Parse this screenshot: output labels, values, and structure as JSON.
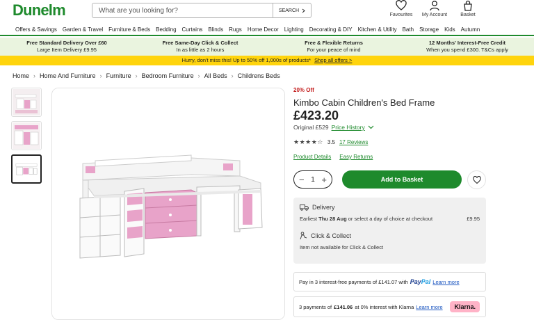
{
  "header": {
    "logo": "Dunelm",
    "search_placeholder": "What are you looking for?",
    "search_button": "SEARCH",
    "icons": [
      {
        "name": "heart-icon",
        "label": "Favourites"
      },
      {
        "name": "user-icon",
        "label": "My Account"
      },
      {
        "name": "basket-icon",
        "label": "Basket"
      }
    ]
  },
  "nav": [
    "Offers & Savings",
    "Garden & Travel",
    "Furniture & Beds",
    "Bedding",
    "Curtains",
    "Blinds",
    "Rugs",
    "Home Decor",
    "Lighting",
    "Decorating & DIY",
    "Kitchen & Utility",
    "Bath",
    "Storage",
    "Kids",
    "Autumn"
  ],
  "usp": [
    {
      "title": "Free Standard Delivery Over £60",
      "sub": "Large Item Delivery £9.95"
    },
    {
      "title": "Free Same-Day Click & Collect",
      "sub": "In as little as 2 hours"
    },
    {
      "title": "Free & Flexible Returns",
      "sub": "For your peace of mind"
    },
    {
      "title": "12 Months' Interest-Free Credit",
      "sub": "When you spend £300. T&Cs apply"
    }
  ],
  "promo": {
    "text": "Hurry, don't miss this! Up to 50% off 1,000s of products*",
    "link": "Shop all offers >"
  },
  "breadcrumb": [
    "Home",
    "Home And Furniture",
    "Furniture",
    "Bedroom Furniture",
    "All Beds",
    "Childrens Beds"
  ],
  "product": {
    "discount": "20% Off",
    "title": "Kimbo Cabin Children's Bed Frame",
    "price": "£423.20",
    "original": "Original £529",
    "price_history": "Price History",
    "rating_value": 3.5,
    "rating": "3.5",
    "reviews": "17 Reviews",
    "product_details": "Product Details",
    "easy_returns": "Easy Returns",
    "quantity": "1",
    "add_to_basket": "Add to Basket"
  },
  "delivery": {
    "title": "Delivery",
    "earliest_prefix": "Earliest",
    "earliest_date": "Thu 28 Aug",
    "earliest_suffix": "or select a day of choice at checkout",
    "price": "£9.95",
    "click_title": "Click & Collect",
    "click_text": "Item not available for Click & Collect"
  },
  "paypal": {
    "text": "Pay in 3 interest-free payments of £141.07 with",
    "brand_a": "Pay",
    "brand_b": "Pal",
    "link": "Learn more"
  },
  "klarna": {
    "prefix": "3 payments of",
    "amount": "£141.06",
    "suffix": "at 0% interest with Klarna",
    "link": "Learn more",
    "badge": "Klarna."
  },
  "colors": {
    "brand_green": "#1e8a2c",
    "promo_yellow": "#ffd40d",
    "discount_red": "#c21a1a",
    "bed_pink": "#e8a3c9"
  }
}
